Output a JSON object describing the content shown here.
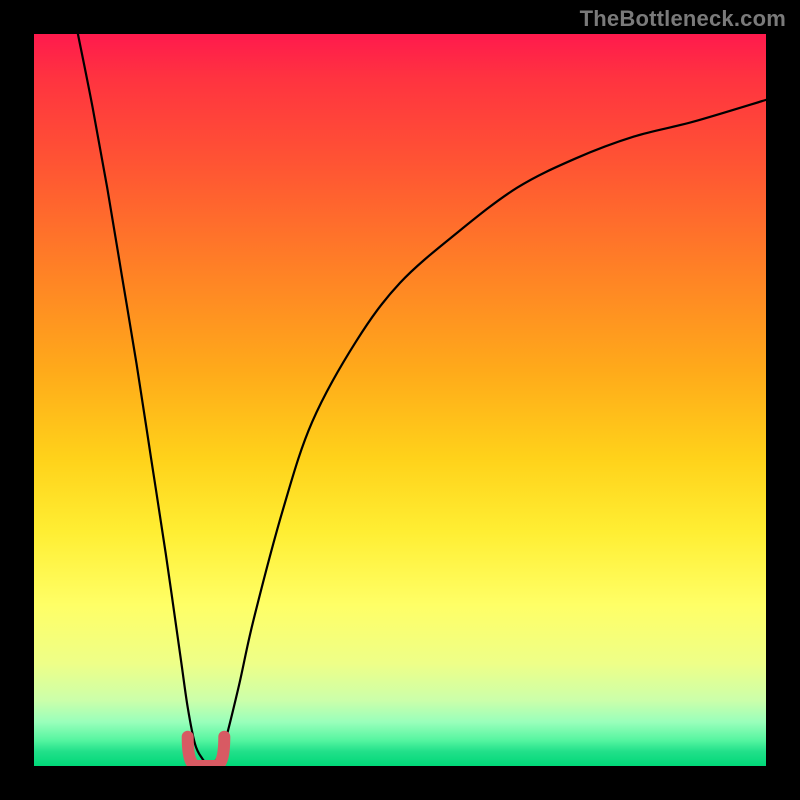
{
  "watermark": "TheBottleneck.com",
  "colors": {
    "frame": "#000000",
    "curve_stroke": "#000000",
    "valley_marker": "#d85a63",
    "gradient_top": "#ff1a4d",
    "gradient_bottom": "#00d878"
  },
  "chart_data": {
    "type": "line",
    "title": "",
    "xlabel": "",
    "ylabel": "",
    "xlim": [
      0,
      100
    ],
    "ylim": [
      0,
      100
    ],
    "series": [
      {
        "name": "bottleneck-curve",
        "x": [
          6,
          8,
          10,
          12,
          14,
          16,
          18,
          20,
          21,
          22,
          23,
          24,
          25,
          26,
          28,
          30,
          34,
          38,
          44,
          50,
          58,
          66,
          74,
          82,
          90,
          100
        ],
        "y": [
          100,
          90,
          79,
          67,
          55,
          42,
          29,
          15,
          8,
          3,
          1,
          0,
          1,
          3,
          11,
          20,
          35,
          47,
          58,
          66,
          73,
          79,
          83,
          86,
          88,
          91
        ]
      }
    ],
    "annotations": [
      {
        "name": "valley-marker",
        "x_range": [
          21,
          26
        ],
        "y_range": [
          0,
          4
        ]
      }
    ],
    "grid": false,
    "legend": false
  }
}
